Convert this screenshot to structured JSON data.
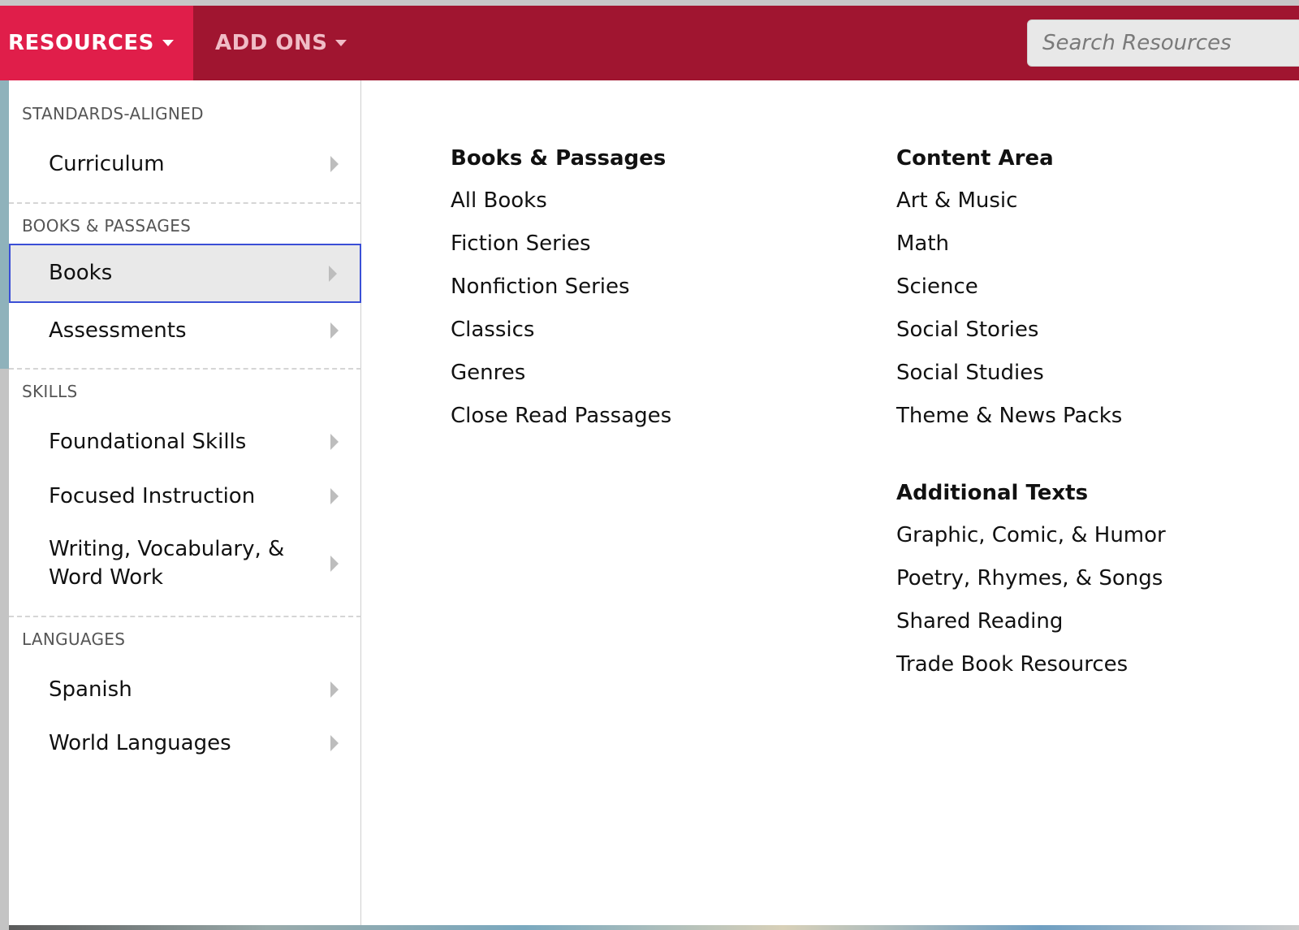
{
  "nav": {
    "resources_label": "RESOURCES",
    "addons_label": "ADD ONS",
    "search_placeholder": "Search Resources"
  },
  "sidebar": {
    "sections": [
      {
        "label": "STANDARDS-ALIGNED",
        "items": [
          "Curriculum"
        ]
      },
      {
        "label": "BOOKS & PASSAGES",
        "items": [
          "Books",
          "Assessments"
        ]
      },
      {
        "label": "SKILLS",
        "items": [
          "Foundational Skills",
          "Focused Instruction",
          "Writing, Vocabulary, & Word Work"
        ]
      },
      {
        "label": "LANGUAGES",
        "items": [
          "Spanish",
          "World Languages"
        ]
      }
    ],
    "selected": "Books"
  },
  "panel": {
    "books_passages": {
      "heading": "Books & Passages",
      "links": [
        "All Books",
        "Fiction Series",
        "Nonfiction Series",
        "Classics",
        "Genres",
        "Close Read Passages"
      ]
    },
    "content_area": {
      "heading": "Content Area",
      "links": [
        "Art & Music",
        "Math",
        "Science",
        "Social Stories",
        "Social Studies",
        "Theme & News Packs"
      ]
    },
    "additional_texts": {
      "heading": "Additional Texts",
      "links": [
        "Graphic, Comic, & Humor",
        "Poetry, Rhymes, & Songs",
        "Shared Reading",
        "Trade Book Resources"
      ]
    }
  },
  "colors": {
    "nav_bg": "#a01530",
    "nav_active": "#e01e4a",
    "selected_border": "#3b4fd6"
  }
}
